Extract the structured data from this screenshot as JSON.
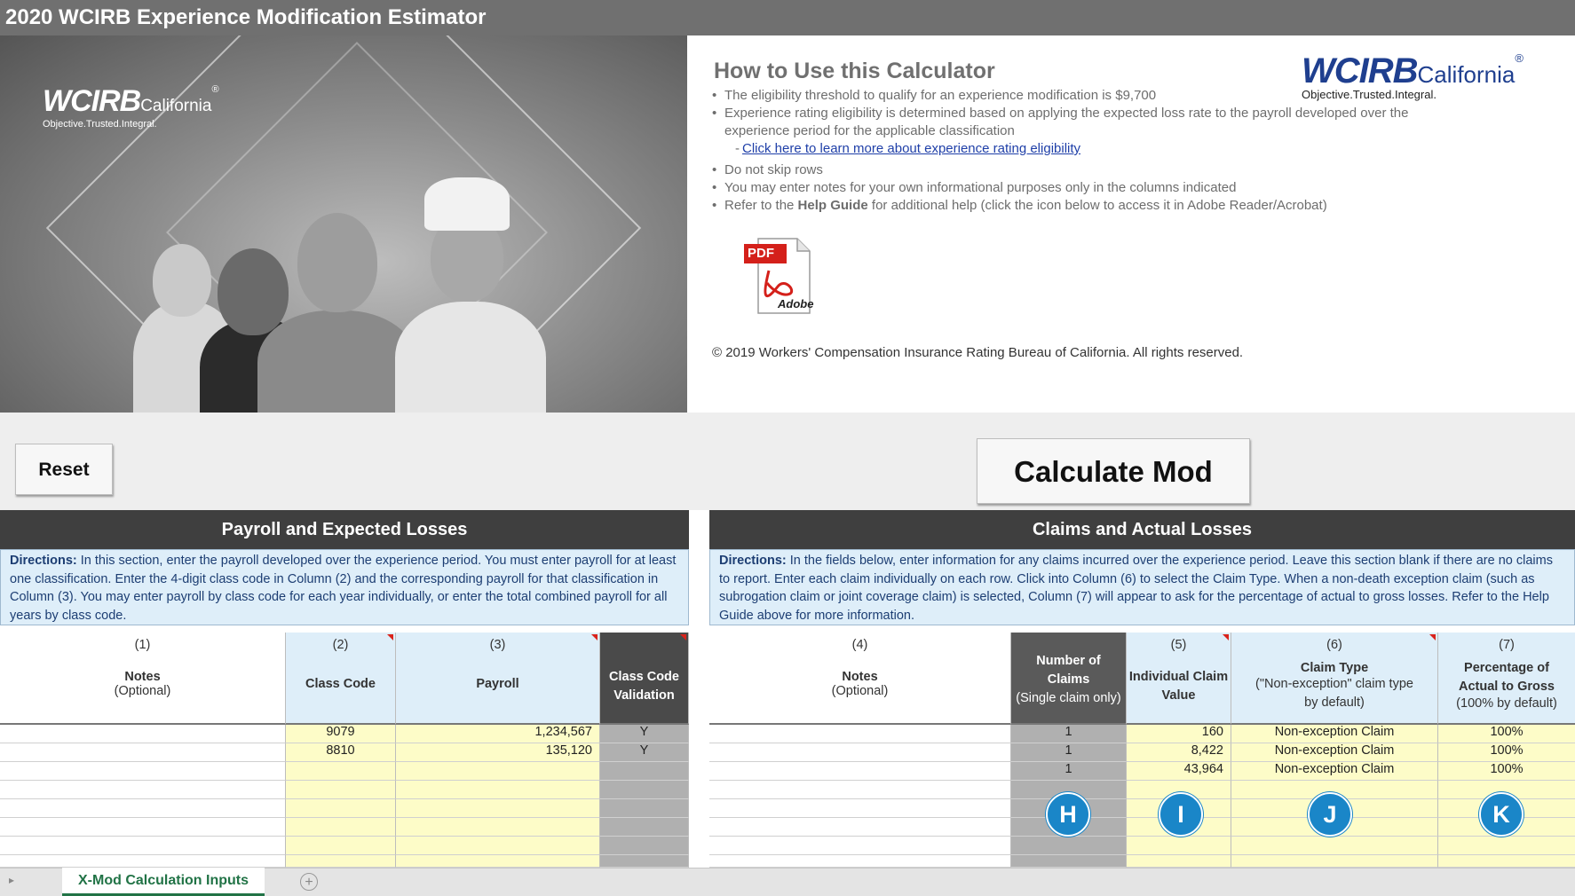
{
  "window": {
    "title": "2020 WCIRB Experience Modification Estimator"
  },
  "hero": {
    "logo_main": "WCIRB",
    "logo_sub": "California",
    "logo_reg": "®",
    "logo_tag": "Objective.Trusted.Integral."
  },
  "howto": {
    "title": "How to Use this Calculator",
    "items": [
      "The eligibility threshold to qualify for an experience modification is $9,700",
      "Experience rating eligibility is determined based on applying the expected loss rate to the payroll developed over the experience period for the applicable classification",
      "Click here to learn more about experience rating eligibility",
      "Do not skip rows",
      "You may enter notes for your own informational purposes only in the columns indicated"
    ],
    "help_prefix": "Refer to the ",
    "help_bold": "Help Guide",
    "help_suffix": " for additional help (click the icon below to access it in Adobe Reader/Acrobat)",
    "pdf_label": "PDF",
    "adobe_label": "Adobe",
    "copyright": "© 2019 Workers' Compensation Insurance Rating Bureau of California. All rights reserved.",
    "logo_main": "WCIRB",
    "logo_sub": "California",
    "logo_reg": "®",
    "logo_tag": "Objective.Trusted.Integral."
  },
  "buttons": {
    "reset": "Reset",
    "calculate": "Calculate Mod"
  },
  "left_section": {
    "title": "Payroll and Expected Losses",
    "directions_label": "Directions:",
    "directions_text": " In this section, enter the payroll developed over the experience period. You must enter payroll for at least one classification. Enter the 4-digit class code in Column (2) and the corresponding payroll for that classification in Column (3). You may enter payroll by class code for each year individually, or enter the total combined payroll for all years by class code.",
    "headers": [
      {
        "num": "(1)",
        "label": "Notes",
        "sub": "(Optional)"
      },
      {
        "num": "(2)",
        "label": "Class Code",
        "sub": ""
      },
      {
        "num": "(3)",
        "label": "Payroll",
        "sub": ""
      },
      {
        "num": "",
        "label": "Class Code Validation",
        "sub": ""
      }
    ],
    "rows": [
      {
        "class_code": "9079",
        "payroll": "1,234,567",
        "validation": "Y"
      },
      {
        "class_code": "8810",
        "payroll": "135,120",
        "validation": "Y"
      }
    ]
  },
  "right_section": {
    "title": "Claims and Actual Losses",
    "directions_label": "Directions:",
    "directions_text": " In the fields below, enter information for any claims incurred over the experience period. Leave this section blank if there are no claims to report. Enter each claim individually on each row. Click into Column (6) to select the Claim Type. When a non-death exception claim (such as subrogation claim or joint coverage claim) is selected, Column (7) will appear to ask for the percentage of actual to gross losses. Refer to the Help Guide above for more information.",
    "headers": [
      {
        "num": "(4)",
        "label": "Notes",
        "sub": "(Optional)"
      },
      {
        "num": "",
        "label": "Number of Claims",
        "sub": "(Single claim only)"
      },
      {
        "num": "(5)",
        "label": "Individual Claim Value",
        "sub": ""
      },
      {
        "num": "(6)",
        "label": "Claim Type",
        "sub": "(\"Non-exception\" claim type by default)"
      },
      {
        "num": "(7)",
        "label": "Percentage of Actual to Gross",
        "sub": "(100% by default)"
      }
    ],
    "rows": [
      {
        "claims": "1",
        "value": "160",
        "type": "Non-exception Claim",
        "pct": "100%"
      },
      {
        "claims": "1",
        "value": "8,422",
        "type": "Non-exception Claim",
        "pct": "100%"
      },
      {
        "claims": "1",
        "value": "43,964",
        "type": "Non-exception Claim",
        "pct": "100%"
      }
    ],
    "markers": [
      "H",
      "I",
      "J",
      "K"
    ]
  },
  "sheet_tabs": {
    "active": "X-Mod Calculation Inputs",
    "add": "+"
  },
  "colors": {
    "accent": "#1a86c8",
    "header_dark": "#3f3f3f",
    "input_yellow": "#fdfcc8",
    "excel_green": "#217346"
  }
}
